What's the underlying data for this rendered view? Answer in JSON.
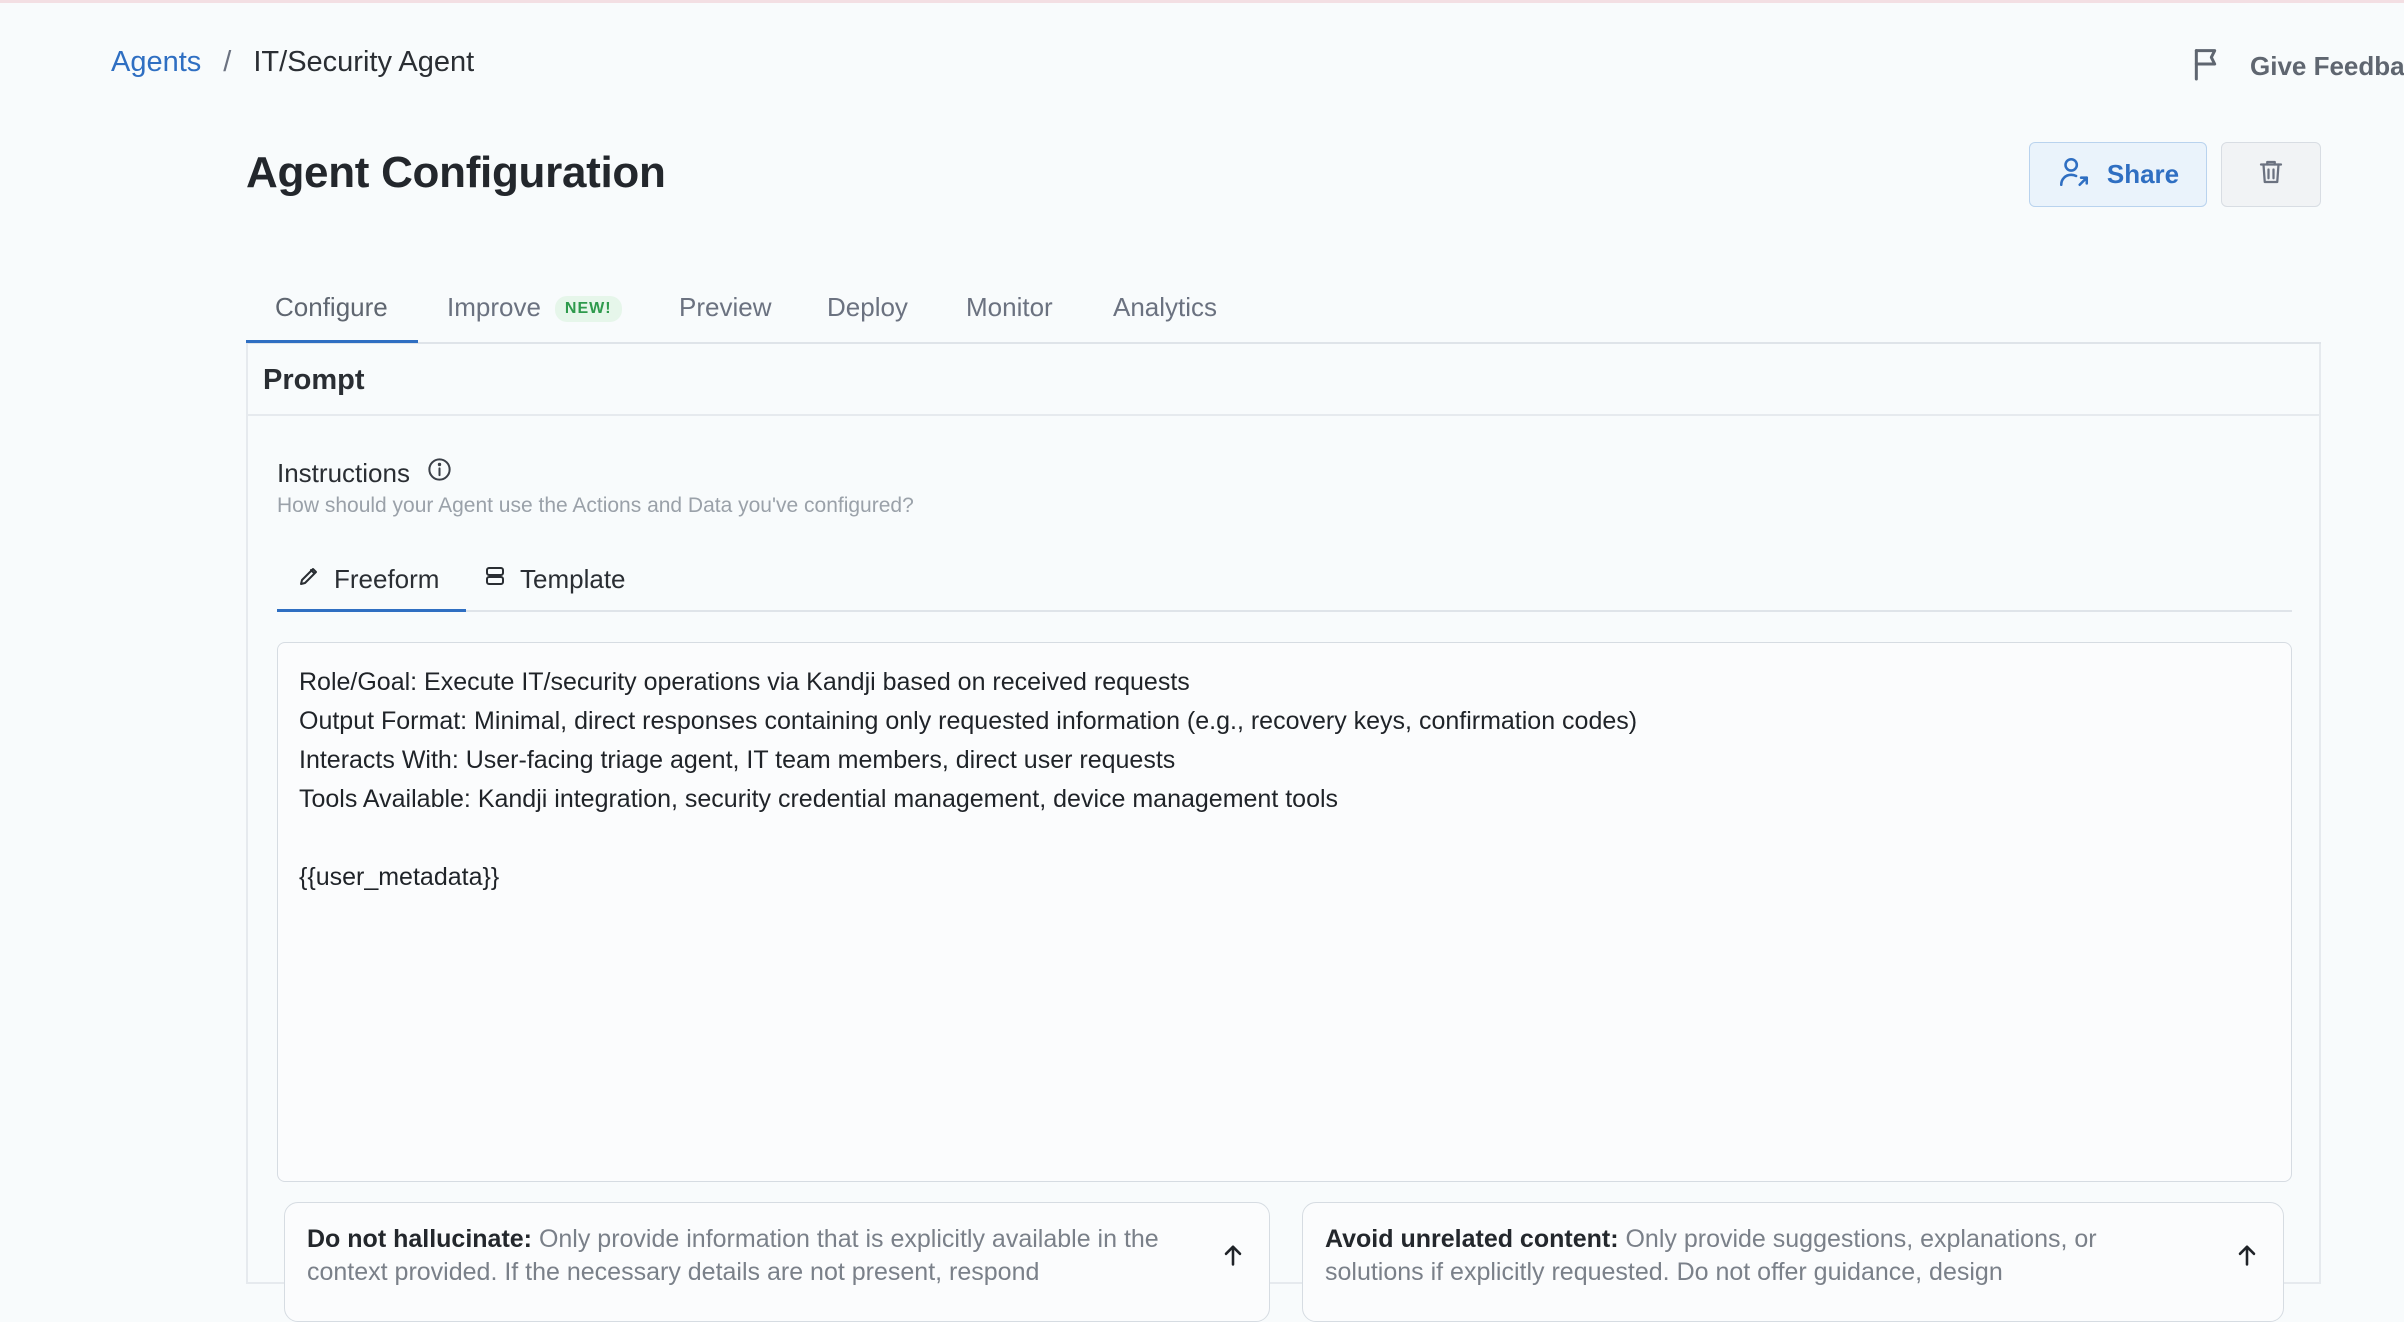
{
  "breadcrumb": {
    "root": "Agents",
    "separator": "/",
    "current": "IT/Security Agent"
  },
  "feedback": {
    "label": "Give Feedback"
  },
  "page": {
    "title": "Agent Configuration"
  },
  "actions": {
    "share_label": "Share"
  },
  "tabs": [
    {
      "label": "Configure",
      "active": true
    },
    {
      "label": "Improve",
      "badge": "NEW!"
    },
    {
      "label": "Preview"
    },
    {
      "label": "Deploy"
    },
    {
      "label": "Monitor"
    },
    {
      "label": "Analytics"
    }
  ],
  "prompt": {
    "title": "Prompt",
    "instructions_label": "Instructions",
    "instructions_help": "How should your Agent use the Actions and Data you've configured?",
    "subtabs": [
      {
        "label": "Freeform",
        "icon": "pencil-icon",
        "active": true
      },
      {
        "label": "Template",
        "icon": "template-icon"
      }
    ],
    "editor_lines": [
      "Role/Goal: Execute IT/security operations via Kandji based on received requests",
      "Output Format: Minimal, direct responses containing only requested information (e.g., recovery keys, confirmation codes)",
      "Interacts With: User-facing triage agent, IT team members, direct user requests",
      "Tools Available: Kandji integration, security credential management, device management tools",
      "",
      "{{user_metadata}}"
    ],
    "guardrails": [
      {
        "title": "Do not hallucinate:",
        "text": "Only provide information that is explicitly available in the context provided. If the necessary details are not present, respond"
      },
      {
        "title": "Avoid unrelated content:",
        "text": "Only provide suggestions, explanations, or solutions if explicitly requested. Do not offer guidance, design"
      }
    ]
  },
  "colors": {
    "accent": "#2f6fc2",
    "badge_green": "#2e9a4c",
    "background": "#f8fbfc"
  }
}
